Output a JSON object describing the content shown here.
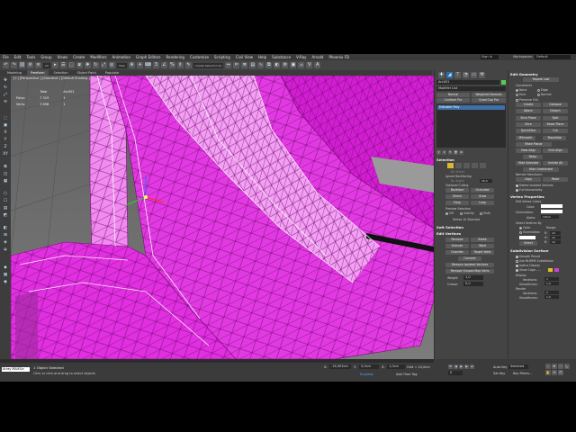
{
  "menubar": {
    "items": [
      "File",
      "Edit",
      "Tools",
      "Group",
      "Views",
      "Create",
      "Modifiers",
      "Animation",
      "Graph Editors",
      "Rendering",
      "Customize",
      "Scripting",
      "Civil View",
      "Help",
      "Substance",
      "V-Ray",
      "Arnold",
      "Phoenix FD"
    ],
    "sign_in": "Sign In",
    "workspaces_label": "Workspaces:",
    "workspaces_value": "Default"
  },
  "toolbar": {
    "filter": "All",
    "view": "View",
    "selection_set": "Create Selection Se"
  },
  "ribbon": {
    "tabs": [
      "Modeling",
      "Freeform",
      "Selection",
      "Object Paint",
      "Populate"
    ],
    "active": "Freeform"
  },
  "viewport": {
    "label": "[+] [Perspective ] [Standard ] [Default Shading ]",
    "stats": {
      "header_total": "Total",
      "header_object": "Arc001",
      "polys_label": "Polys:",
      "polys_total": "7 319",
      "polys_object": "1",
      "verts_label": "Verts:",
      "verts_total": "3 698",
      "verts_object": "1"
    },
    "mesh_color": "#e020e0"
  },
  "lefttools": {
    "icons": [
      "✥",
      "↻",
      "⤢",
      "⟲",
      "⬚",
      "▣",
      "X",
      "Y",
      "Z",
      "XY",
      "⧉",
      "◫",
      "▦",
      "⬡",
      "☐",
      "▤",
      "◩",
      "◧",
      "⊞",
      "◈",
      "⬙",
      "◆",
      "▩",
      "◉"
    ]
  },
  "command_panel": {
    "object_name": "Arc001",
    "modifier_list": "Modifier List",
    "buttons_row1": [
      "Normal",
      "Weighted Normals"
    ],
    "buttons_row2": [
      "Conform Pro",
      "Quad Cap Pro"
    ],
    "stack_item": "Editable Poly",
    "selection_header": "Selection",
    "by_vertex": "By Vertex",
    "ignore_backfacing": "Ignore Backfacing",
    "by_angle": "By Angle:",
    "by_angle_val": "45,0",
    "optional_culling": "Optional Culling",
    "backface": "Backface",
    "occluded": "Occluded",
    "shrink": "Shrink",
    "grow": "Grow",
    "ring": "Ring",
    "loop": "Loop",
    "preview_selection": "Preview Selection",
    "preview_off": "Off",
    "preview_subobj": "SubObj",
    "preview_multi": "Multi",
    "selected_text": "Vertex 10 Selected",
    "soft_selection": "Soft Selection",
    "edit_vertices": "Edit Vertices",
    "remove": "Remove",
    "break": "Break",
    "extrude": "Extrude",
    "weld": "Weld",
    "chamfer": "Chamfer",
    "target_weld": "Target Weld",
    "connect": "Connect",
    "remove_isolated": "Remove Isolated Vertices",
    "remove_unused": "Remove Unused Map Verts",
    "weight_label": "Weight:",
    "weight_val": "1,0",
    "crease_label": "Crease:",
    "crease_val": "0,0"
  },
  "modifier_panel": {
    "edit_geometry": "Edit Geometry",
    "repeat_last": "Repeat Last",
    "constraints": "Constraints",
    "c_none": "None",
    "c_edge": "Edge",
    "c_face": "Face",
    "c_normal": "Normal",
    "preserve_uvs": "Preserve UVs",
    "create": "Create",
    "collapse": "Collapse",
    "attach": "Attach",
    "detach": "Detach",
    "slice_plane": "Slice Plane",
    "split": "Split",
    "slice": "Slice",
    "reset_plane": "Reset Plane",
    "quickslice": "QuickSlice",
    "cut": "Cut",
    "msmooth": "MSmooth",
    "tessellate": "Tessellate",
    "make_planar": "Make Planar",
    "view_align": "View Align",
    "grid_align": "Grid Align",
    "relax": "Relax",
    "hide_selected": "Hide Selected",
    "unhide_all": "Unhide All",
    "hide_unselected": "Hide Unselected",
    "named_selections": "Named Selections:",
    "copy": "Copy",
    "paste": "Paste",
    "delete_isolated": "Delete Isolated Vertices",
    "full_interactivity": "Full Interactivity",
    "vertex_properties": "Vertex Properties",
    "edit_vertex_colors": "Edit Vertex Colors",
    "color_label": "Color:",
    "illumination_label": "Illumination:",
    "alpha_label": "Alpha:",
    "alpha_val": "100,0",
    "select_vertices_by": "Select Vertices By",
    "sv_color": "Color",
    "sv_illumination": "Illumination",
    "range": "Range:",
    "r_label": "R:",
    "g_label": "G:",
    "b_label": "B:",
    "range_val": "10",
    "select_btn": "Select",
    "subdivision_surface": "Subdivision Surface",
    "smooth_result": "Smooth Result",
    "use_nurms": "Use NURMS Subdivision",
    "isoline_display": "Isoline Display",
    "show_cage": "Show Cage......",
    "display": "Display",
    "iterations_label": "Iterations:",
    "iterations_val": "1",
    "smoothness_label": "Smoothness:",
    "smoothness_val": "1,0",
    "render": "Render",
    "iterations2_val": "0",
    "smoothness2_val": "1,0"
  },
  "bottom": {
    "maxscript": "Array MAXScr",
    "status": "1 Object Selected",
    "prompt": "Click or click-and-drag to select objects",
    "x_label": "X:",
    "x_val": "-16,903cm",
    "y_label": "Y:",
    "y_val": "0,0cm",
    "z_label": "Z:",
    "z_val": "1,0cm",
    "grid": "Grid = 10,0cm",
    "add_time_tag": "Add Time Tag",
    "enabled": "Enabled:",
    "auto_key": "Auto Key",
    "selected": "Selected",
    "set_key": "Set Key",
    "key_filters": "Key Filters...",
    "frame": "0"
  }
}
